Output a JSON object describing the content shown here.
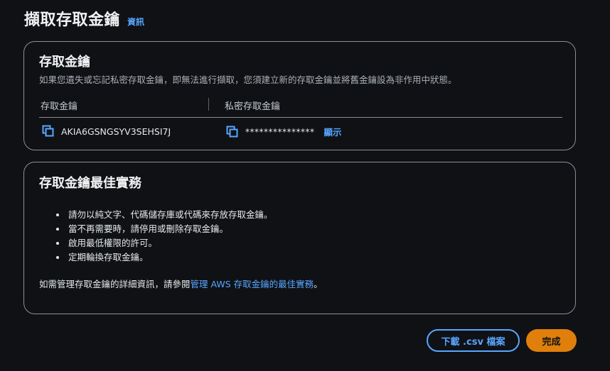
{
  "header": {
    "title": "擷取存取金鑰",
    "info_link": "資訊"
  },
  "access_keys_card": {
    "title": "存取金鑰",
    "description": "如果您遺失或忘記私密存取金鑰，即無法進行擷取，您須建立新的存取金鑰並將舊金鑰設為非作用中狀態。",
    "columns": {
      "access_key": "存取金鑰",
      "secret_key": "私密存取金鑰"
    },
    "access_key_value": "AKIA6GSNGSYV3SEHSI7J",
    "secret_key_masked": "***************",
    "show_link": "顯示"
  },
  "best_practices_card": {
    "title": "存取金鑰最佳實務",
    "items": [
      "請勿以純文字、代碼儲存庫或代碼來存放存取金鑰。",
      "當不再需要時，請停用或刪除存取金鑰。",
      "啟用最低權限的許可。",
      "定期輪換存取金鑰。"
    ],
    "footer_prefix": "如需管理存取金鑰的詳細資訊，請參閱",
    "footer_link": "管理 AWS 存取金鑰的最佳實務",
    "footer_suffix": "。"
  },
  "actions": {
    "download_label": "下載 .csv 檔案",
    "done_label": "完成"
  },
  "colors": {
    "accent_link": "#58a6ff",
    "primary_button": "#e07f0b",
    "background": "#0f1115",
    "border": "#8a8f95"
  },
  "icons": {
    "copy": "copy-icon"
  }
}
